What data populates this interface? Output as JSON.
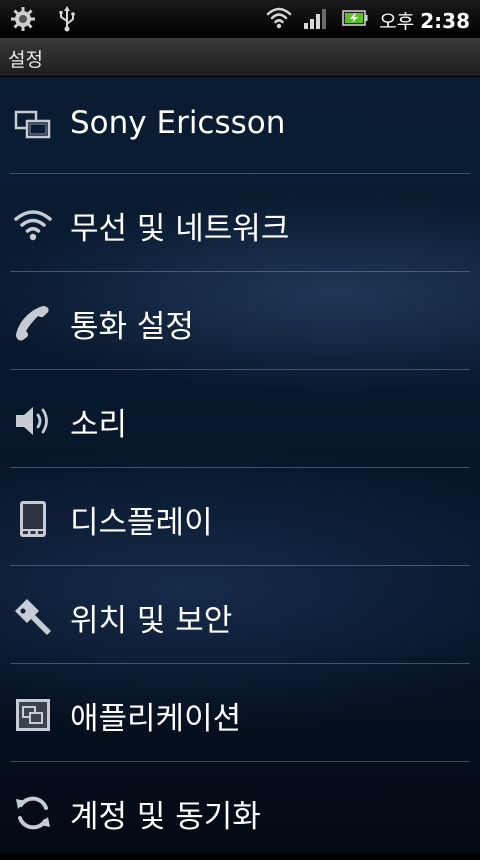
{
  "status_bar": {
    "ampm": "오후",
    "time": "2:38",
    "icons": [
      "settings-notification-icon",
      "usb-icon",
      "wifi-icon",
      "signal-icon",
      "battery-charging-icon"
    ]
  },
  "title": "설정",
  "settings": [
    {
      "label": "Sony Ericsson",
      "icon": "sony-ericsson-icon"
    },
    {
      "label": "무선 및 네트워크",
      "icon": "wifi-icon"
    },
    {
      "label": "통화 설정",
      "icon": "phone-handset-icon"
    },
    {
      "label": "소리",
      "icon": "speaker-icon"
    },
    {
      "label": "디스플레이",
      "icon": "display-icon"
    },
    {
      "label": "위치 및 보안",
      "icon": "key-icon"
    },
    {
      "label": "애플리케이션",
      "icon": "applications-icon"
    },
    {
      "label": "계정 및 동기화",
      "icon": "sync-icon"
    }
  ]
}
